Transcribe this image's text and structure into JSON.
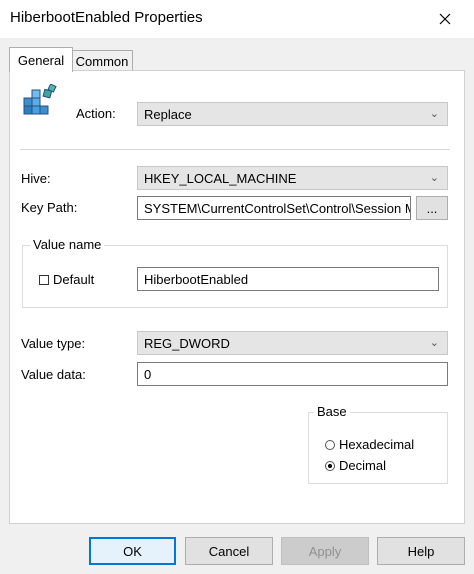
{
  "window": {
    "title": "HiberbootEnabled Properties"
  },
  "tabs": [
    {
      "label": "General",
      "active": true
    },
    {
      "label": "Common",
      "active": false
    }
  ],
  "action": {
    "label": "Action:",
    "value": "Replace"
  },
  "hive": {
    "label": "Hive:",
    "value": "HKEY_LOCAL_MACHINE"
  },
  "key_path": {
    "label": "Key Path:",
    "value": "SYSTEM\\CurrentControlSet\\Control\\Session Mar",
    "browse_label": "..."
  },
  "value_name": {
    "group_label": "Value name",
    "default_label": "Default",
    "default_checked": false,
    "value": "HiberbootEnabled"
  },
  "value_type": {
    "label": "Value type:",
    "value": "REG_DWORD"
  },
  "value_data": {
    "label": "Value data:",
    "value": "0"
  },
  "base": {
    "group_label": "Base",
    "options": [
      {
        "label": "Hexadecimal",
        "selected": false
      },
      {
        "label": "Decimal",
        "selected": true
      }
    ]
  },
  "buttons": {
    "ok": "OK",
    "cancel": "Cancel",
    "apply": "Apply",
    "help": "Help"
  },
  "colors": {
    "accent": "#0078d7",
    "disabled_text": "#8f8f8f",
    "disabled_bg": "#cccccc"
  }
}
